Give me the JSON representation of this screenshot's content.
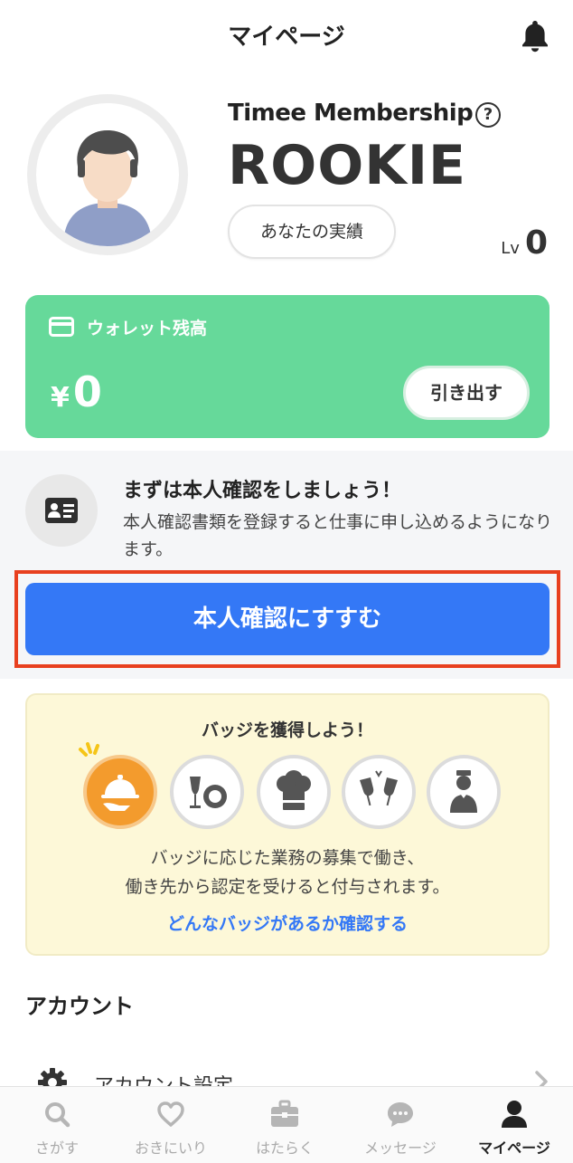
{
  "header": {
    "title": "マイページ",
    "notification_icon": "bell-icon"
  },
  "profile": {
    "membership_label": "Timee Membership",
    "rank": "ROOKIE",
    "achievements_button": "あなたの実績",
    "level_label": "Lv",
    "level_value": "0"
  },
  "wallet": {
    "label": "ウォレット残高",
    "currency": "¥",
    "balance": "0",
    "withdraw_button": "引き出す",
    "color": "#66d99a"
  },
  "identity": {
    "title": "まずは本人確認をしましょう！",
    "description": "本人確認書類を登録すると仕事に申し込めるようになります。",
    "button": "本人確認にすすむ",
    "button_color": "#3478f6",
    "highlight_color": "#e8401f"
  },
  "badges": {
    "title": "バッジを獲得しよう！",
    "icons": [
      "serving-cloche-badge-icon",
      "wine-dish-badge-icon",
      "chef-hat-badge-icon",
      "toast-glasses-badge-icon",
      "staff-person-badge-icon"
    ],
    "description_line1": "バッジに応じた業務の募集で働き、",
    "description_line2": "働き先から認定を受けると付与されます。",
    "link": "どんなバッジがあるか確認する"
  },
  "account": {
    "section_title": "アカウント",
    "settings_label": "アカウント設定"
  },
  "tabbar": {
    "tabs": [
      {
        "label": "さがす",
        "icon": "search-icon"
      },
      {
        "label": "おきにいり",
        "icon": "heart-icon"
      },
      {
        "label": "はたらく",
        "icon": "briefcase-icon"
      },
      {
        "label": "メッセージ",
        "icon": "chat-icon"
      },
      {
        "label": "マイページ",
        "icon": "person-icon",
        "active": true
      }
    ]
  }
}
